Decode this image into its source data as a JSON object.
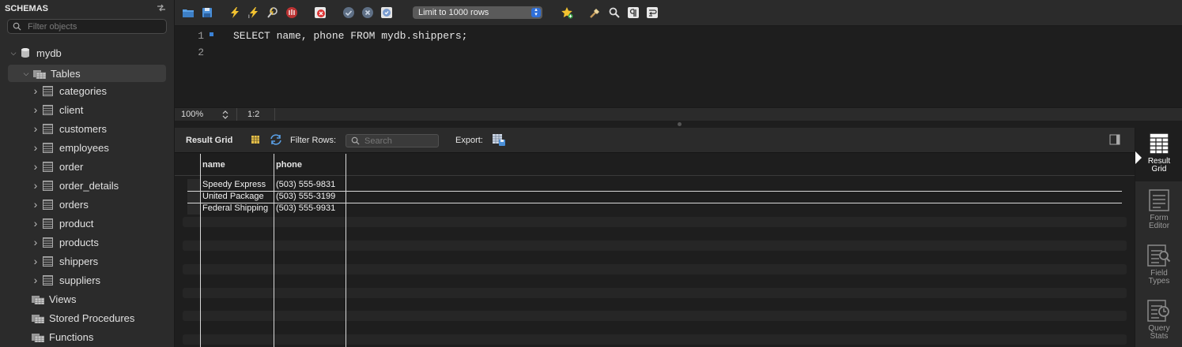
{
  "sidebar": {
    "title": "SCHEMAS",
    "filter_placeholder": "Filter objects",
    "schema": "mydb",
    "tables_label": "Tables",
    "tables": [
      "categories",
      "client",
      "customers",
      "employees",
      "order",
      "order_details",
      "orders",
      "product",
      "products",
      "shippers",
      "suppliers"
    ],
    "folders": [
      "Views",
      "Stored Procedures",
      "Functions"
    ]
  },
  "toolbar": {
    "limit_select": "Limit to 1000 rows"
  },
  "editor": {
    "lines": [
      {
        "num": "1",
        "text": "SELECT name, phone FROM mydb.shippers;"
      },
      {
        "num": "2",
        "text": ""
      }
    ]
  },
  "status": {
    "zoom": "100%",
    "position": "1:2"
  },
  "result_toolbar": {
    "result_grid_label": "Result Grid",
    "filter_rows_label": "Filter Rows:",
    "search_placeholder": "Search",
    "export_label": "Export:"
  },
  "grid": {
    "columns": [
      "name",
      "phone"
    ],
    "rows": [
      [
        "Speedy Express",
        "(503) 555-9831"
      ],
      [
        "United Package",
        "(503) 555-3199"
      ],
      [
        "Federal Shipping",
        "(503) 555-9931"
      ]
    ]
  },
  "right_panel": {
    "buttons": [
      {
        "line1": "Result",
        "line2": "Grid"
      },
      {
        "line1": "Form",
        "line2": "Editor"
      },
      {
        "line1": "Field",
        "line2": "Types"
      },
      {
        "line1": "Query",
        "line2": "Stats"
      }
    ]
  }
}
